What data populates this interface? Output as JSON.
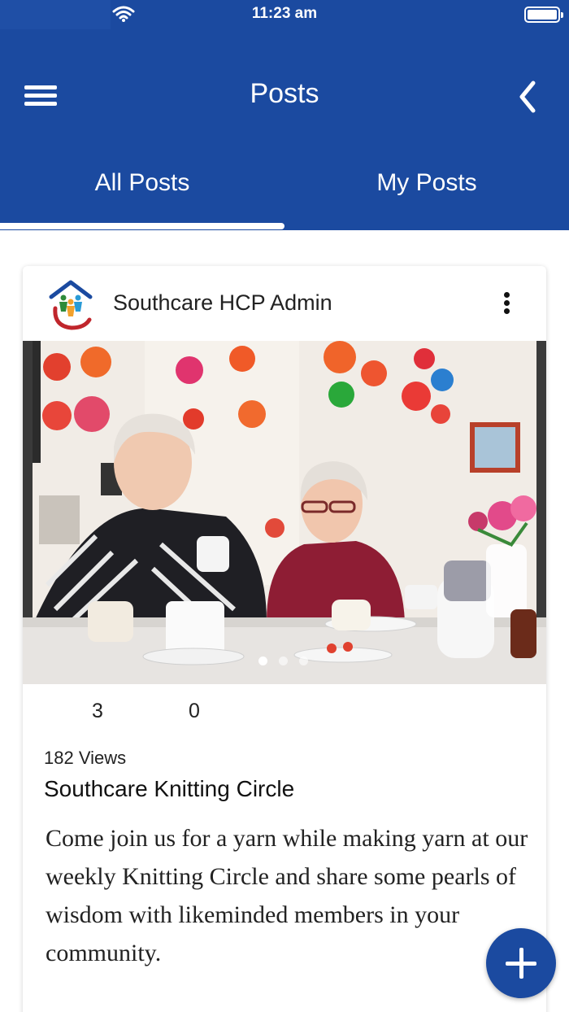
{
  "status_bar": {
    "time": "11:23 am"
  },
  "header": {
    "title": "Posts"
  },
  "tabs": [
    {
      "label": "All Posts",
      "active": true
    },
    {
      "label": "My Posts",
      "active": false
    }
  ],
  "post": {
    "author": "Southcare HCP Admin",
    "likes": "3",
    "comments": "0",
    "views": "182 Views",
    "title": "Southcare Knitting Circle",
    "body": "Come join us for a yarn while making yarn at our weekly Knitting Circle and share some pearls of wisdom with likeminded members in your community."
  },
  "colors": {
    "primary": "#1b4aa0",
    "text": "#222222"
  },
  "icons": [
    "wifi-icon",
    "battery-icon",
    "menu-icon",
    "back-chevron-icon",
    "more-vertical-icon",
    "plus-icon"
  ]
}
